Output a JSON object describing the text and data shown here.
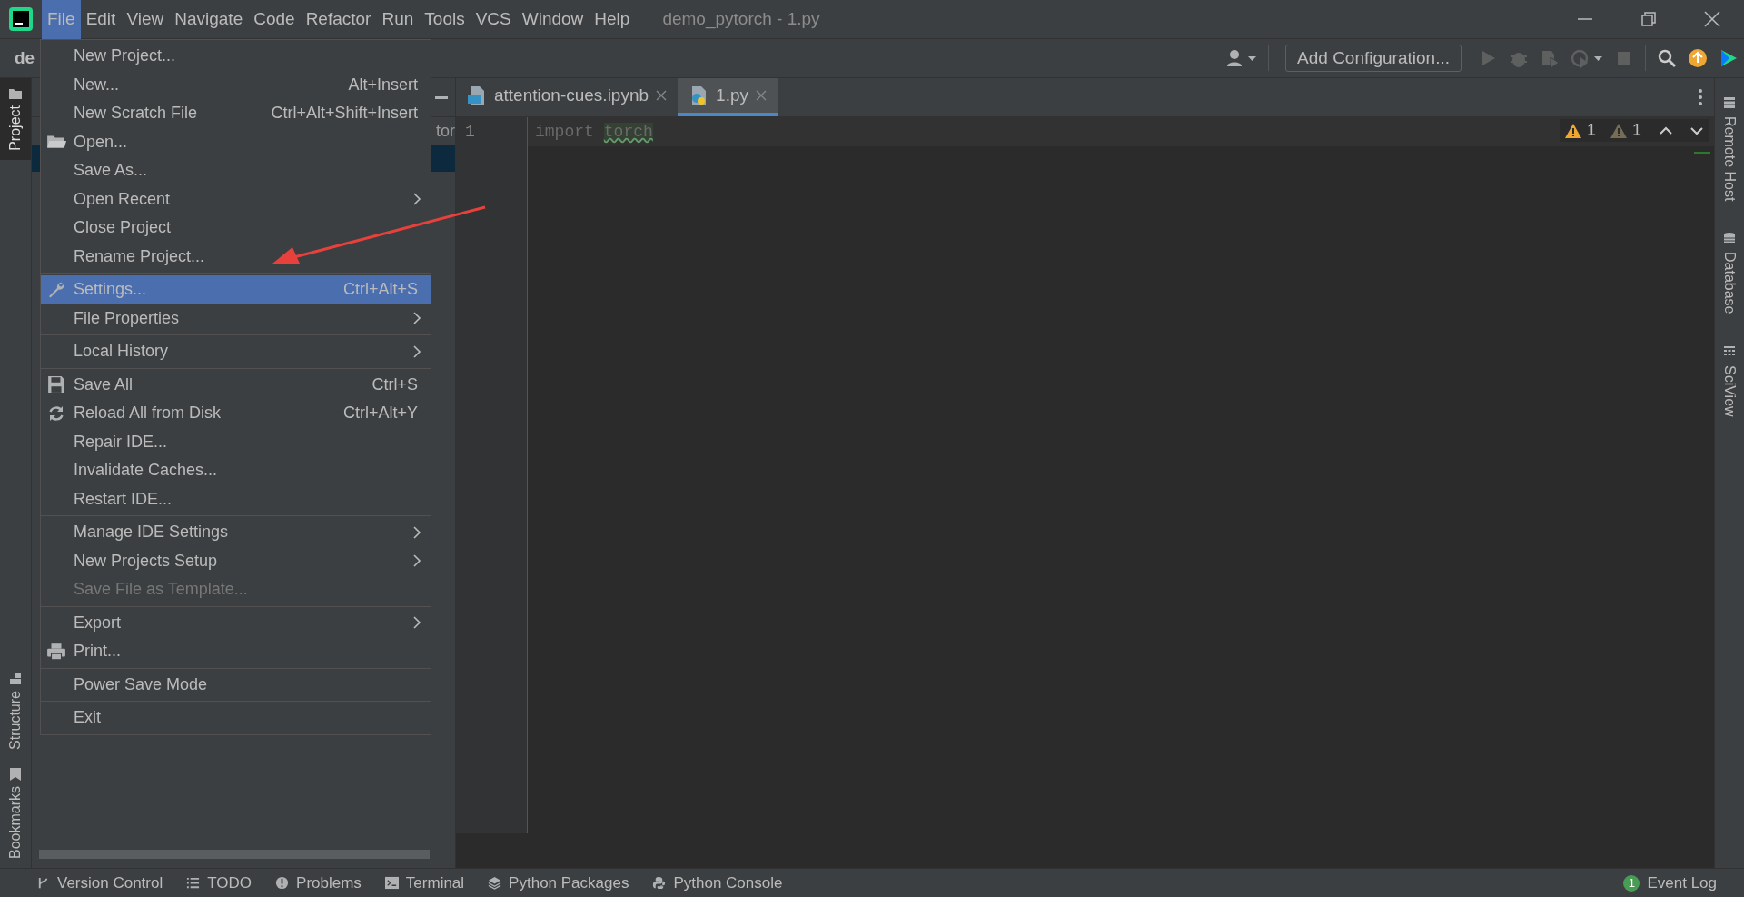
{
  "menu_bar": [
    {
      "label": "File",
      "selected": true
    },
    {
      "label": "Edit",
      "selected": false
    },
    {
      "label": "View",
      "selected": false
    },
    {
      "label": "Navigate",
      "selected": false
    },
    {
      "label": "Code",
      "selected": false
    },
    {
      "label": "Refactor",
      "selected": false
    },
    {
      "label": "Run",
      "selected": false
    },
    {
      "label": "Tools",
      "selected": false
    },
    {
      "label": "VCS",
      "selected": false
    },
    {
      "label": "Window",
      "selected": false
    },
    {
      "label": "Help",
      "selected": false
    }
  ],
  "window_title": "demo_pytorch - 1.py",
  "navigation_bar": {
    "breadcrumb": "de"
  },
  "toolbar": {
    "add_configuration": "Add Configuration..."
  },
  "left_tool_windows": {
    "top": [
      {
        "label": "Project",
        "selected": true
      }
    ],
    "bottom": [
      {
        "label": "Structure",
        "selected": false
      },
      {
        "label": "Bookmarks",
        "selected": false
      }
    ]
  },
  "project_panel": {
    "visible_text": "tor"
  },
  "editor_tabs": [
    {
      "label": "attention-cues.ipynb",
      "kind": "notebook",
      "selected": false
    },
    {
      "label": "1.py",
      "kind": "python",
      "selected": true
    }
  ],
  "editor": {
    "lines": [
      {
        "number": "1",
        "tokens": [
          {
            "text": "import",
            "kind": "keyword"
          },
          {
            "text": "torch",
            "kind": "module"
          }
        ]
      }
    ],
    "warnings": "1",
    "weak_warnings": "1"
  },
  "right_tool_windows": [
    {
      "label": "Remote Host",
      "kind": "server"
    },
    {
      "label": "Database",
      "kind": "database"
    },
    {
      "label": "SciView",
      "kind": "grid"
    }
  ],
  "file_menu": {
    "groups": [
      {
        "items": [
          {
            "label": "New Project...",
            "kind": "plain",
            "submenu": false,
            "disabled": false,
            "selected": false
          },
          {
            "label": "New...",
            "shortcut": "Alt+Insert",
            "kind": "plain",
            "submenu": false,
            "disabled": false,
            "selected": false
          },
          {
            "label": "New Scratch File",
            "shortcut": "Ctrl+Alt+Shift+Insert",
            "kind": "plain",
            "submenu": false,
            "disabled": false,
            "selected": false
          },
          {
            "label": "Open...",
            "kind": "folder",
            "submenu": false,
            "disabled": false,
            "selected": false
          },
          {
            "label": "Save As...",
            "kind": "plain",
            "submenu": false,
            "disabled": false,
            "selected": false
          },
          {
            "label": "Open Recent",
            "kind": "plain",
            "submenu": true,
            "disabled": false,
            "selected": false
          },
          {
            "label": "Close Project",
            "kind": "plain",
            "submenu": false,
            "disabled": false,
            "selected": false
          },
          {
            "label": "Rename Project...",
            "kind": "plain",
            "submenu": false,
            "disabled": false,
            "selected": false
          }
        ]
      },
      {
        "items": [
          {
            "label": "Settings...",
            "shortcut": "Ctrl+Alt+S",
            "kind": "wrench",
            "submenu": false,
            "disabled": false,
            "selected": true
          },
          {
            "label": "File Properties",
            "kind": "plain",
            "submenu": true,
            "disabled": false,
            "selected": false
          }
        ]
      },
      {
        "items": [
          {
            "label": "Local History",
            "kind": "plain",
            "submenu": true,
            "disabled": false,
            "selected": false
          }
        ]
      },
      {
        "items": [
          {
            "label": "Save All",
            "shortcut": "Ctrl+S",
            "kind": "disk",
            "submenu": false,
            "disabled": false,
            "selected": false
          },
          {
            "label": "Reload All from Disk",
            "shortcut": "Ctrl+Alt+Y",
            "kind": "reload",
            "submenu": false,
            "disabled": false,
            "selected": false
          },
          {
            "label": "Repair IDE...",
            "kind": "plain",
            "submenu": false,
            "disabled": false,
            "selected": false
          },
          {
            "label": "Invalidate Caches...",
            "kind": "plain",
            "submenu": false,
            "disabled": false,
            "selected": false
          },
          {
            "label": "Restart IDE...",
            "kind": "plain",
            "submenu": false,
            "disabled": false,
            "selected": false
          }
        ]
      },
      {
        "items": [
          {
            "label": "Manage IDE Settings",
            "kind": "plain",
            "submenu": true,
            "disabled": false,
            "selected": false
          },
          {
            "label": "New Projects Setup",
            "kind": "plain",
            "submenu": true,
            "disabled": false,
            "selected": false
          },
          {
            "label": "Save File as Template...",
            "kind": "plain",
            "submenu": false,
            "disabled": true,
            "selected": false
          }
        ]
      },
      {
        "items": [
          {
            "label": "Export",
            "kind": "plain",
            "submenu": true,
            "disabled": false,
            "selected": false
          },
          {
            "label": "Print...",
            "kind": "printer",
            "submenu": false,
            "disabled": false,
            "selected": false
          }
        ]
      },
      {
        "items": [
          {
            "label": "Power Save Mode",
            "kind": "plain",
            "submenu": false,
            "disabled": false,
            "selected": false
          }
        ]
      },
      {
        "items": [
          {
            "label": "Exit",
            "kind": "plain",
            "submenu": false,
            "disabled": false,
            "selected": false
          }
        ]
      }
    ]
  },
  "status_bar": {
    "tool_windows": [
      {
        "label": "Version Control",
        "kind": "branch"
      },
      {
        "label": "TODO",
        "kind": "list"
      },
      {
        "label": "Problems",
        "kind": "alert"
      },
      {
        "label": "Terminal",
        "kind": "terminal"
      },
      {
        "label": "Python Packages",
        "kind": "layers"
      },
      {
        "label": "Python Console",
        "kind": "python"
      }
    ],
    "event_log": {
      "count": "1",
      "label": "Event Log"
    }
  }
}
